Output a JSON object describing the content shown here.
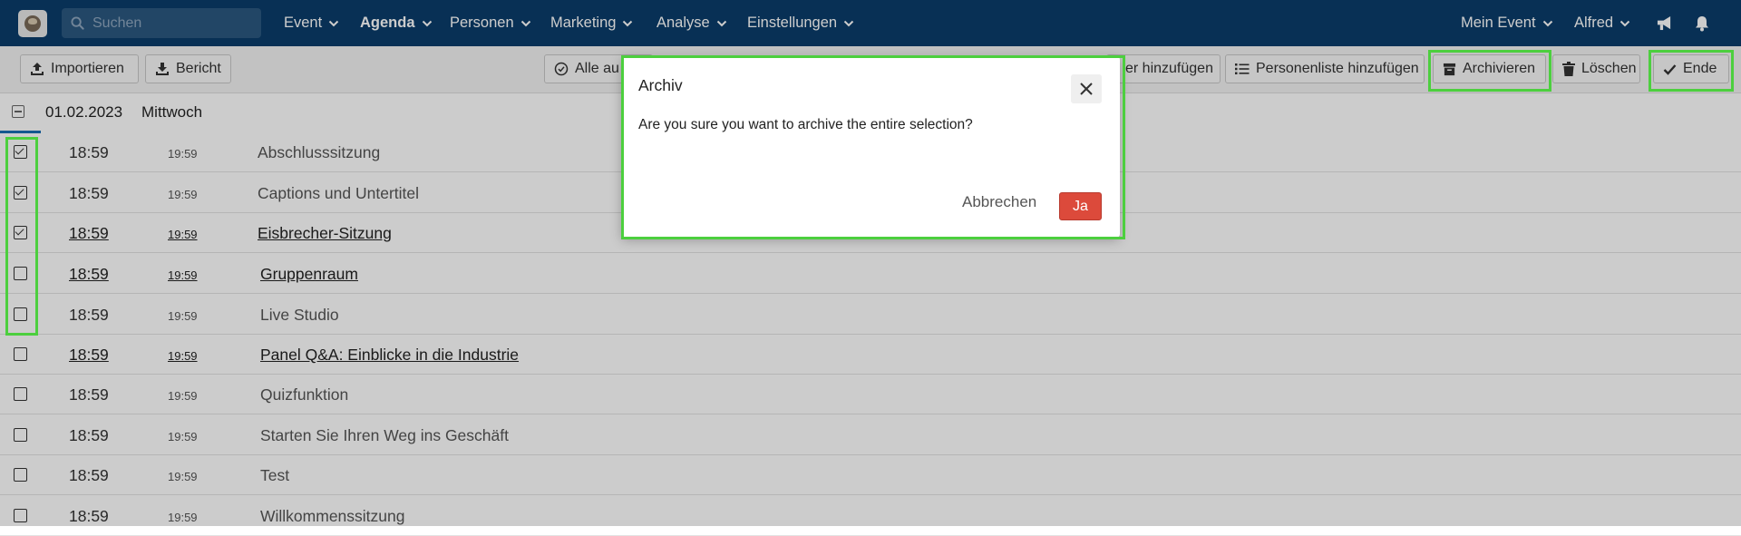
{
  "nav": {
    "search_placeholder": "Suchen",
    "menus": [
      "Event",
      "Agenda",
      "Personen",
      "Marketing",
      "Analyse",
      "Einstellungen"
    ],
    "active_menu": "Agenda",
    "event_menu": "Mein Event",
    "user_menu": "Alfred",
    "icons": [
      "megaphone-icon",
      "bell-icon"
    ]
  },
  "toolbar": {
    "import_label": "Importieren",
    "report_label": "Bericht",
    "select_all_label": "Alle au",
    "add_label": "er hinzufügen",
    "add_person_list_label": "Personenliste hinzufügen",
    "archive_label": "Archivieren",
    "delete_label": "Löschen",
    "end_label": "Ende"
  },
  "list": {
    "date": "01.02.2023",
    "weekday": "Mittwoch",
    "rows": [
      {
        "start": "18:59",
        "end": "19:59",
        "title": "Abschlusssitzung",
        "checked": true,
        "link": false
      },
      {
        "start": "18:59",
        "end": "19:59",
        "title": "Captions und Untertitel",
        "checked": true,
        "link": false
      },
      {
        "start": "18:59",
        "end": "19:59",
        "title": "Eisbrecher-Sitzung",
        "checked": true,
        "link": true
      },
      {
        "start": "18:59",
        "end": "19:59",
        "title": "Gruppenraum",
        "checked": false,
        "link": true
      },
      {
        "start": "18:59",
        "end": "19:59",
        "title": "Live Studio",
        "checked": false,
        "link": false
      },
      {
        "start": "18:59",
        "end": "19:59",
        "title": "Panel Q&A: Einblicke in die Industrie",
        "checked": false,
        "link": true
      },
      {
        "start": "18:59",
        "end": "19:59",
        "title": "Quizfunktion",
        "checked": false,
        "link": false
      },
      {
        "start": "18:59",
        "end": "19:59",
        "title": "Starten Sie Ihren Weg ins Geschäft",
        "checked": false,
        "link": false
      },
      {
        "start": "18:59",
        "end": "19:59",
        "title": "Test",
        "checked": false,
        "link": false
      },
      {
        "start": "18:59",
        "end": "19:59",
        "title": "Willkommenssitzung",
        "checked": false,
        "link": false
      }
    ]
  },
  "modal": {
    "title": "Archiv",
    "message": "Are you sure you want to archive the entire selection?",
    "cancel_label": "Abbrechen",
    "confirm_label": "Ja"
  },
  "colors": {
    "nav_bg": "#0a3d6b",
    "highlight": "#4ccf3e",
    "confirm": "#dc4a3b"
  }
}
